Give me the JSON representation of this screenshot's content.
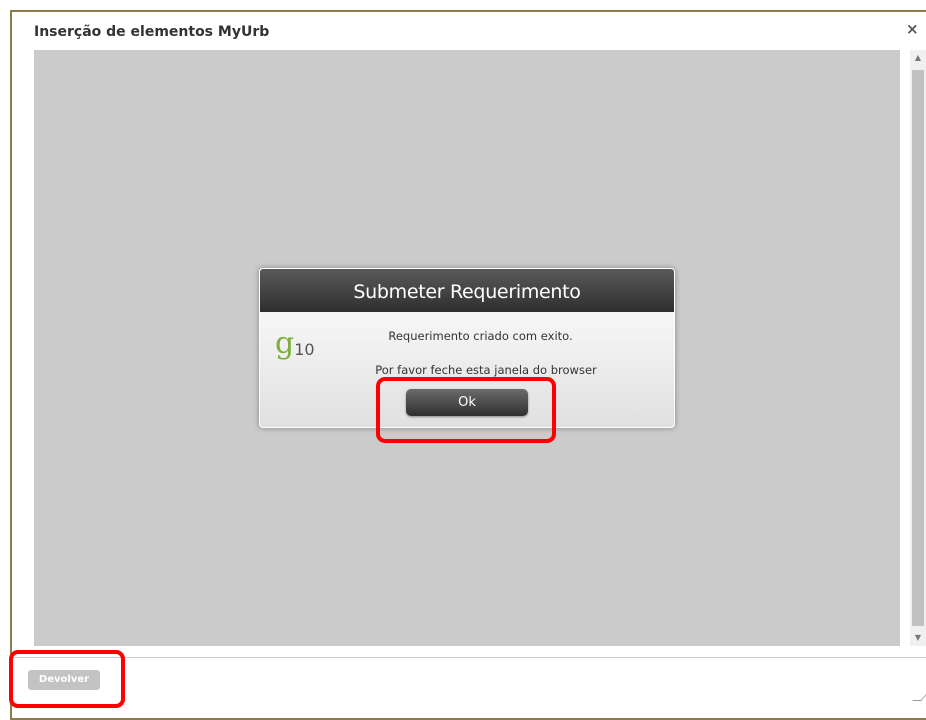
{
  "window": {
    "title": "Inserção de elementos MyUrb",
    "close_label": "×"
  },
  "dialog": {
    "title": "Submeter Requerimento",
    "logo_main": "g",
    "logo_sub": "10",
    "message_line1": "Requerimento criado com exito.",
    "message_line2": "Por favor feche esta janela do browser",
    "ok_label": "Ok"
  },
  "footer": {
    "devolver_label": "Devolver"
  },
  "scrollbar": {
    "up_arrow": "▲",
    "down_arrow": "▼"
  },
  "colors": {
    "frame_border": "#8b7d4a",
    "content_background": "#cbcbcb",
    "highlight": "#ff0000",
    "logo_green": "#7cae3a"
  }
}
